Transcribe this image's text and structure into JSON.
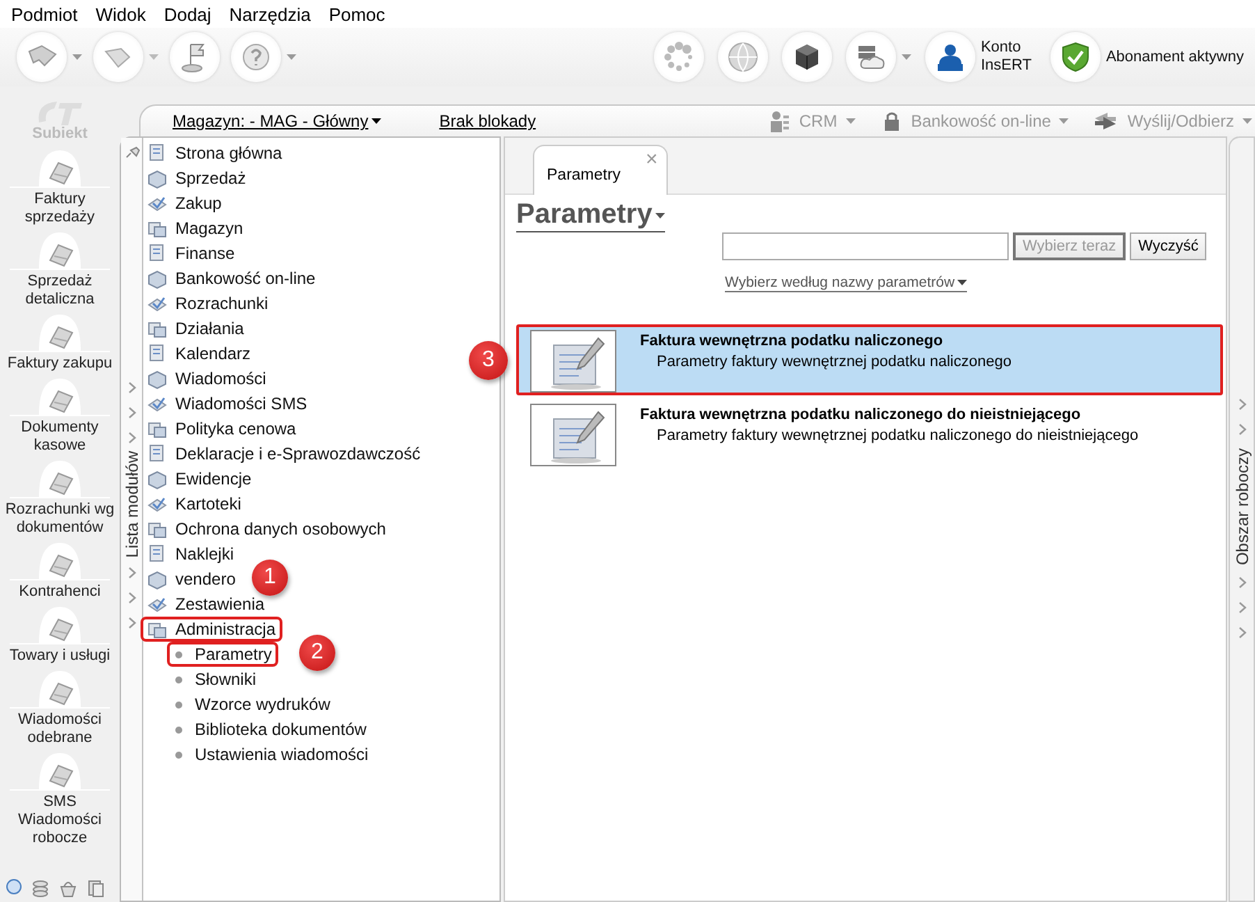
{
  "menu_bar": [
    {
      "label": "Podmiot"
    },
    {
      "label": "Widok"
    },
    {
      "label": "Dodaj"
    },
    {
      "label": "Narzędzia"
    },
    {
      "label": "Pomoc"
    }
  ],
  "toolbar": {
    "account": "Konto InsERT",
    "subscription": "Abonament aktywny"
  },
  "sidebar": {
    "app_name": "Subiekt",
    "items": [
      {
        "label": "Faktury sprzedaży"
      },
      {
        "label": "Sprzedaż detaliczna"
      },
      {
        "label": "Faktury zakupu"
      },
      {
        "label": "Dokumenty kasowe"
      },
      {
        "label": "Rozrachunki wg dokumentów"
      },
      {
        "label": "Kontrahenci"
      },
      {
        "label": "Towary i usługi"
      },
      {
        "label": "Wiadomości odebrane"
      },
      {
        "label": "SMS Wiadomości robocze"
      }
    ]
  },
  "header": {
    "warehouse": "Magazyn: - MAG - Główny",
    "lock_status": "Brak blokady",
    "menus": [
      {
        "label": "CRM",
        "disabled": true
      },
      {
        "label": "Bankowość on-line",
        "disabled": true
      },
      {
        "label": "Wyślij/Odbierz",
        "disabled": true
      }
    ]
  },
  "module_panel": {
    "title": "Lista modułów",
    "items": [
      {
        "label": "Strona główna",
        "outlined": false
      },
      {
        "label": "Sprzedaż",
        "outlined": false
      },
      {
        "label": "Zakup",
        "outlined": false
      },
      {
        "label": "Magazyn",
        "outlined": false
      },
      {
        "label": "Finanse",
        "outlined": false
      },
      {
        "label": "Bankowość on-line",
        "outlined": false
      },
      {
        "label": "Rozrachunki",
        "outlined": false
      },
      {
        "label": "Działania",
        "outlined": false
      },
      {
        "label": "Kalendarz",
        "outlined": false
      },
      {
        "label": "Wiadomości",
        "outlined": false
      },
      {
        "label": "Wiadomości SMS",
        "outlined": false
      },
      {
        "label": "Polityka cenowa",
        "outlined": false
      },
      {
        "label": "Deklaracje i e-Sprawozdawczość",
        "outlined": false
      },
      {
        "label": "Ewidencje",
        "outlined": false
      },
      {
        "label": "Kartoteki",
        "outlined": false
      },
      {
        "label": "Ochrona danych osobowych",
        "outlined": false
      },
      {
        "label": "Naklejki",
        "outlined": false
      },
      {
        "label": "vendero",
        "outlined": false,
        "badge": "1"
      },
      {
        "label": "Zestawienia",
        "outlined": false
      },
      {
        "label": "Administracja",
        "outlined": true,
        "children": [
          {
            "label": "Parametry",
            "outlined": true,
            "badge": "2"
          },
          {
            "label": "Słowniki",
            "outlined": false
          },
          {
            "label": "Wzorce wydruków",
            "outlined": false
          },
          {
            "label": "Biblioteka dokumentów",
            "outlined": false
          },
          {
            "label": "Ustawienia wiadomości",
            "outlined": false
          }
        ]
      }
    ]
  },
  "tabs": [
    {
      "label": "Parametry",
      "selected": true,
      "close": "×"
    }
  ],
  "parameters": {
    "title": "Parametry",
    "buttons": [
      {
        "label": "Wybierz teraz",
        "disabled": true
      },
      {
        "label": "Wyczyść",
        "disabled": false
      }
    ],
    "filter": "Wybierz według nazwy parametrów",
    "results": [
      {
        "title": "Faktura wewnętrzna podatku naliczonego",
        "description": "Parametry faktury wewnętrznej podatku naliczonego",
        "selected": true,
        "outlined": true,
        "badge": "3"
      },
      {
        "title": "Faktura wewnętrzna podatku naliczonego do nieistniejącego",
        "description": "Parametry faktury wewnętrznej podatku naliczonego do nieistniejącego",
        "selected": false,
        "outlined": false
      }
    ]
  },
  "workspace": {
    "title": "Obszar roboczy"
  }
}
